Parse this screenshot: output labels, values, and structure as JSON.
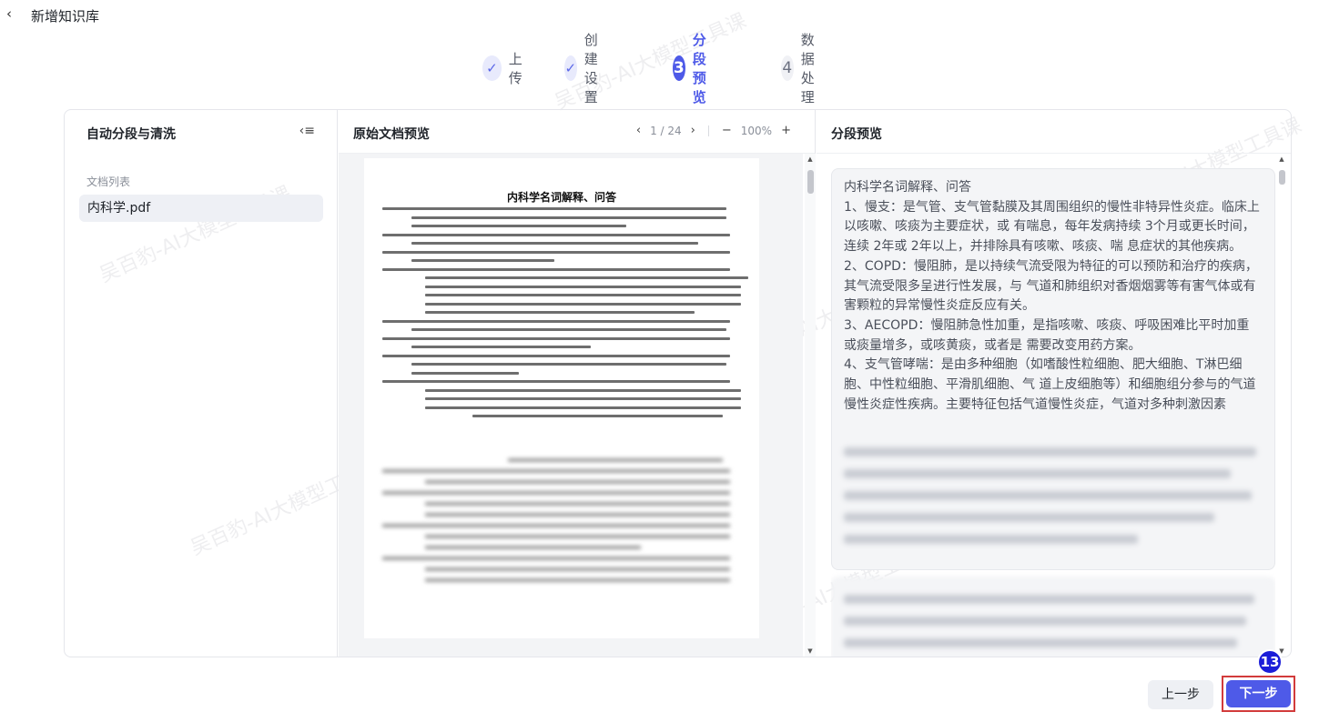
{
  "header": {
    "title": "新增知识库",
    "back_icon": "chevron-left-icon"
  },
  "steps": [
    {
      "label": "上传",
      "status": "done",
      "marker": "✓"
    },
    {
      "label": "创建设置",
      "status": "done",
      "marker": "✓"
    },
    {
      "label": "分段预览",
      "status": "active",
      "marker": "3"
    },
    {
      "label": "数据处理",
      "status": "todo",
      "marker": "4"
    }
  ],
  "left_panel": {
    "title": "自动分段与清洗",
    "list_label": "文档列表",
    "documents": [
      "内科学.pdf"
    ]
  },
  "middle_panel": {
    "title": "原始文档预览",
    "page_indicator": "1 / 24",
    "zoom": "100%",
    "pdf_title": "内科学名词解释、问答"
  },
  "right_panel": {
    "title": "分段预览",
    "segment_text": "内科学名词解释、问答\n1、慢支：是气管、支气管黏膜及其周围组织的慢性非特异性炎症。临床上以咳嗽、咳痰为主要症状，或 有喘息，每年发病持续 3个月或更长时间，连续 2年或 2年以上，并排除具有咳嗽、咳痰、喘 息症状的其他疾病。\n2、COPD：慢阻肺，是以持续气流受限为特征的可以预防和治疗的疾病，其气流受限多呈进行性发展，与 气道和肺组织对香烟烟雾等有害气体或有害颗粒的异常慢性炎症反应有关。\n3、AECOPD：慢阻肺急性加重，是指咳嗽、咳痰、呼吸困难比平时加重或痰量增多，或咳黄痰，或者是 需要改变用药方案。\n4、支气管哮喘：是由多种细胞（如嗜酸性粒细胞、肥大细胞、T淋巴细胞、中性粒细胞、平滑肌细胞、气 道上皮细胞等）和细胞组分参与的气道慢性炎症性疾病。主要特征包括气道慢性炎症，气道对多种刺激因素"
  },
  "footer": {
    "prev_label": "上一步",
    "next_label": "下一步",
    "badge": "13"
  },
  "watermark": "吴百豹-AI大模型工具课",
  "colors": {
    "accent": "#4e5ae8",
    "highlight_border": "#d23b3b",
    "badge": "#1c1ed8"
  }
}
